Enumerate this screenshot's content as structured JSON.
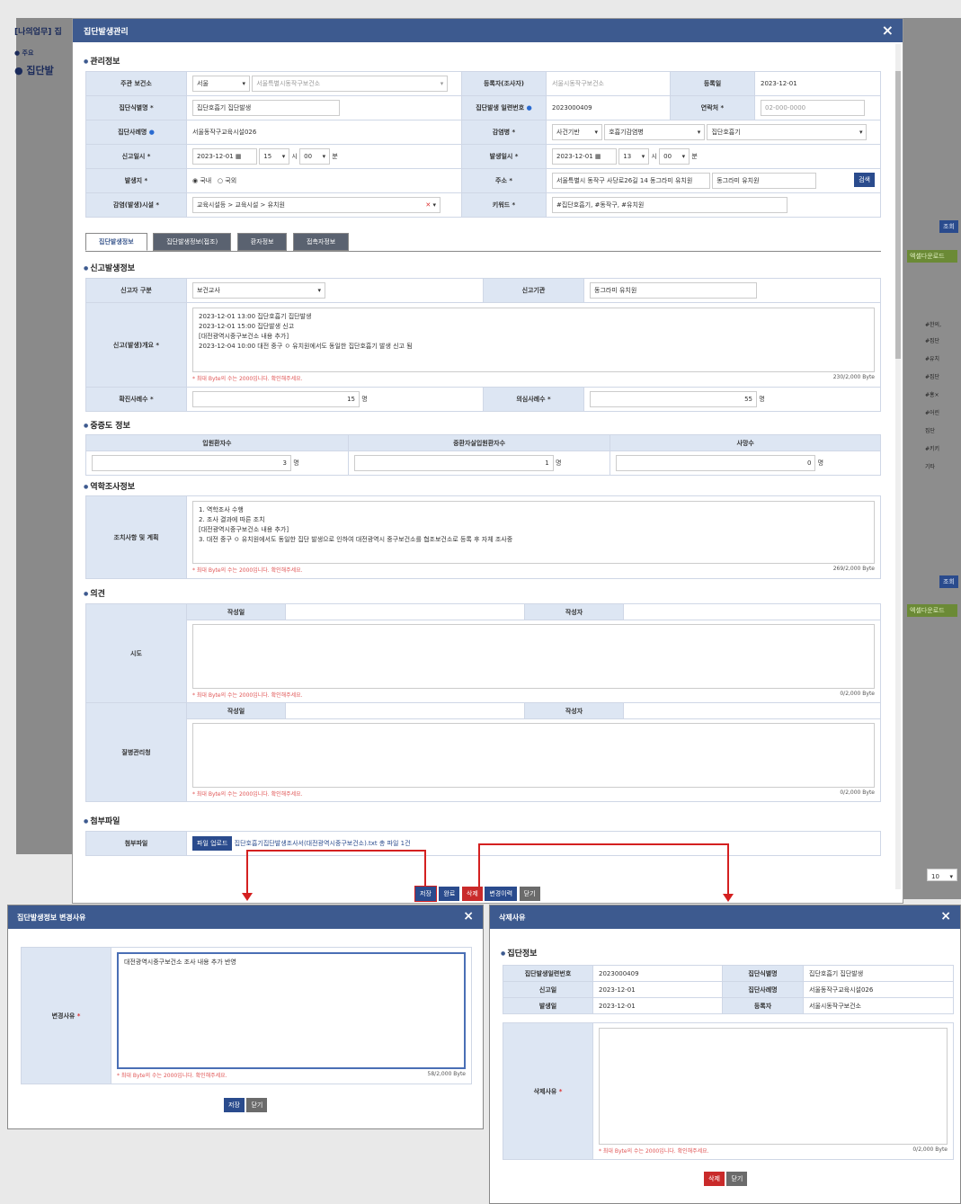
{
  "background": {
    "left_texts": [
      "[나의업무] 집",
      "● 주요 ",
      "● 집단발"
    ],
    "right_chip1": "엑셀다운로드",
    "right_chip2": "엑셀다운로드",
    "right_btn1": "조회",
    "right_btn2": "조회",
    "right_rows": [
      "#한의, ",
      "#집단",
      "#유치",
      "#집단",
      "#홍×",
      "#어린",
      "집단",
      "#키키",
      "기타"
    ],
    "page_size": "10"
  },
  "modal": {
    "title": "집단발생관리",
    "close_icon": "×",
    "sections": {
      "mgmt": "관리정보",
      "report": "신고발생정보",
      "severity": "중증도 정보",
      "epi": "역학조사정보",
      "opinion": "의견",
      "attach": "첨부파일"
    },
    "mgmt": {
      "health_center_label": "주관 보건소",
      "health_center_region": "서울",
      "health_center_value": "서울특별시동작구보건소",
      "registrant_label": "등록자(조사자)",
      "registrant_value": "서울시동작구보건소",
      "reg_date_label": "등록일",
      "reg_date_value": "2023-12-01",
      "group_name_label": "집단식별명 *",
      "group_name_value": "집단호흡기 집단발생",
      "group_no_label": "집단발생 일련번호",
      "group_no_value": "2023000409",
      "contact_label": "연락처 *",
      "contact_value": "02-000-0000",
      "case_name_label": "집단사례명",
      "case_name_value": "서울동작구교육시설026",
      "disease_label": "감염병 *",
      "disease_opt1": "사건기반",
      "disease_opt2": "호흡기감염병",
      "disease_opt3": "집단호흡기",
      "report_date_label": "신고일시 *",
      "report_date": "2023-12-01",
      "report_hour": "15",
      "report_min": "00",
      "occur_date_label": "발생일시 *",
      "occur_date": "2023-12-01",
      "occur_hour": "13",
      "occur_min": "00",
      "hour_unit": "시",
      "min_unit": "분",
      "origin_label": "발생지 *",
      "origin_domestic": "국내",
      "origin_foreign": "국외",
      "address_label": "주소 *",
      "address_value": "서울특별시 동작구 사당로26길 14 동그라미 유치원",
      "address_detail": "동그라미 유치원",
      "search_btn": "검색",
      "facility_label": "감염(발생)시설 *",
      "facility_value": "교육시설등 > 교육시설 > 유치원",
      "keyword_label": "키워드 *",
      "keyword_value": "#집단호흡기, #동작구, #유치원"
    },
    "tabs": [
      "집단발생정보",
      "집단발생정보(접조)",
      "환자정보",
      "접촉자정보"
    ],
    "report": {
      "reporter_type_label": "신고자 구분",
      "reporter_type_value": "보건교사",
      "agency_label": "신고기관",
      "agency_value": "동그라미 유치원",
      "summary_label": "신고(발생)개요 *",
      "summary_lines": [
        "2023-12-01 13:00 집단호흡기 집단발생",
        "2023-12-01 15:00 집단발생 신고",
        "[대전광역시중구보건소 내용 추가]",
        "2023-12-04 10:00 대전 중구 ㅇ 유치원에서도 동일한 집단호흡기 발생 신고 됨"
      ],
      "hint": "* 최대 Byte의 수는 2000입니다. 확인해주세요.",
      "summary_bytes": "230/2,000 Byte",
      "confirmed_label": "확진사례수 *",
      "confirmed_value": "15",
      "suspected_label": "의심사례수 *",
      "suspected_value": "55",
      "unit": "명"
    },
    "severity": {
      "inpatient_label": "입원환자수",
      "inpatient_value": "3",
      "icu_label": "중환자실입원환자수",
      "icu_value": "1",
      "death_label": "사망수",
      "death_value": "0"
    },
    "epi": {
      "label": "조치사항 및 계획",
      "lines": [
        "1. 역학조사 수행",
        "2. 조사 결과에 따른 조치",
        "[대전광역시중구보건소 내용 추가]",
        "3. 대전 중구 ㅇ 유치원에서도 동일한 집단 발생으로 인하여 대전광역시 중구보건소를 협조보건소로 등록 후 자체 조사중"
      ],
      "bytes": "269/2,000 Byte"
    },
    "opinion": {
      "city_label": "시도",
      "kdca_label": "질병관리청",
      "date_col": "작성일",
      "writer_col": "작성자",
      "bytes": "0/2,000 Byte"
    },
    "attach": {
      "label": "첨부파일",
      "upload_btn": "파일 업로드",
      "file_text": "집단호흡기집단발생조사서(대전광역시중구보건소).txt 총 파일 1건"
    },
    "footer_buttons": {
      "save": "저장",
      "complete": "완료",
      "delete": "삭제",
      "history": "변경이력",
      "close": "닫기"
    }
  },
  "change_popup": {
    "title": "집단발생정보 변경사유",
    "reason_label": "변경사유",
    "reason_value": "대전광역시중구보건소 조사 내용 추가 반영",
    "hint": "* 최대 Byte의 수는 2000입니다. 확인해주세요.",
    "bytes": "58/2,000 Byte",
    "save": "저장",
    "close": "닫기"
  },
  "delete_popup": {
    "title": "삭제사유",
    "section": "집단정보",
    "no_label": "집단발생일련번호",
    "no_value": "2023000409",
    "name_label": "집단식별명",
    "name_value": "집단호흡기 집단발생",
    "report_label": "신고일",
    "report_value": "2023-12-01",
    "case_label": "집단사례명",
    "case_value": "서울동작구교육시설026",
    "occur_label": "발생일",
    "occur_value": "2023-12-01",
    "registrant_label": "등록자",
    "registrant_value": "서울시동작구보건소",
    "reason_label": "삭제사유",
    "hint": "* 최대 Byte의 수는 2000입니다. 확인해주세요.",
    "bytes": "0/2,000 Byte",
    "delete": "삭제",
    "close": "닫기"
  },
  "colors": {
    "header": "#3d5a8f",
    "label_bg": "#dde6f3",
    "accent_red": "#d42020",
    "button_blue": "#2a4b8d"
  }
}
